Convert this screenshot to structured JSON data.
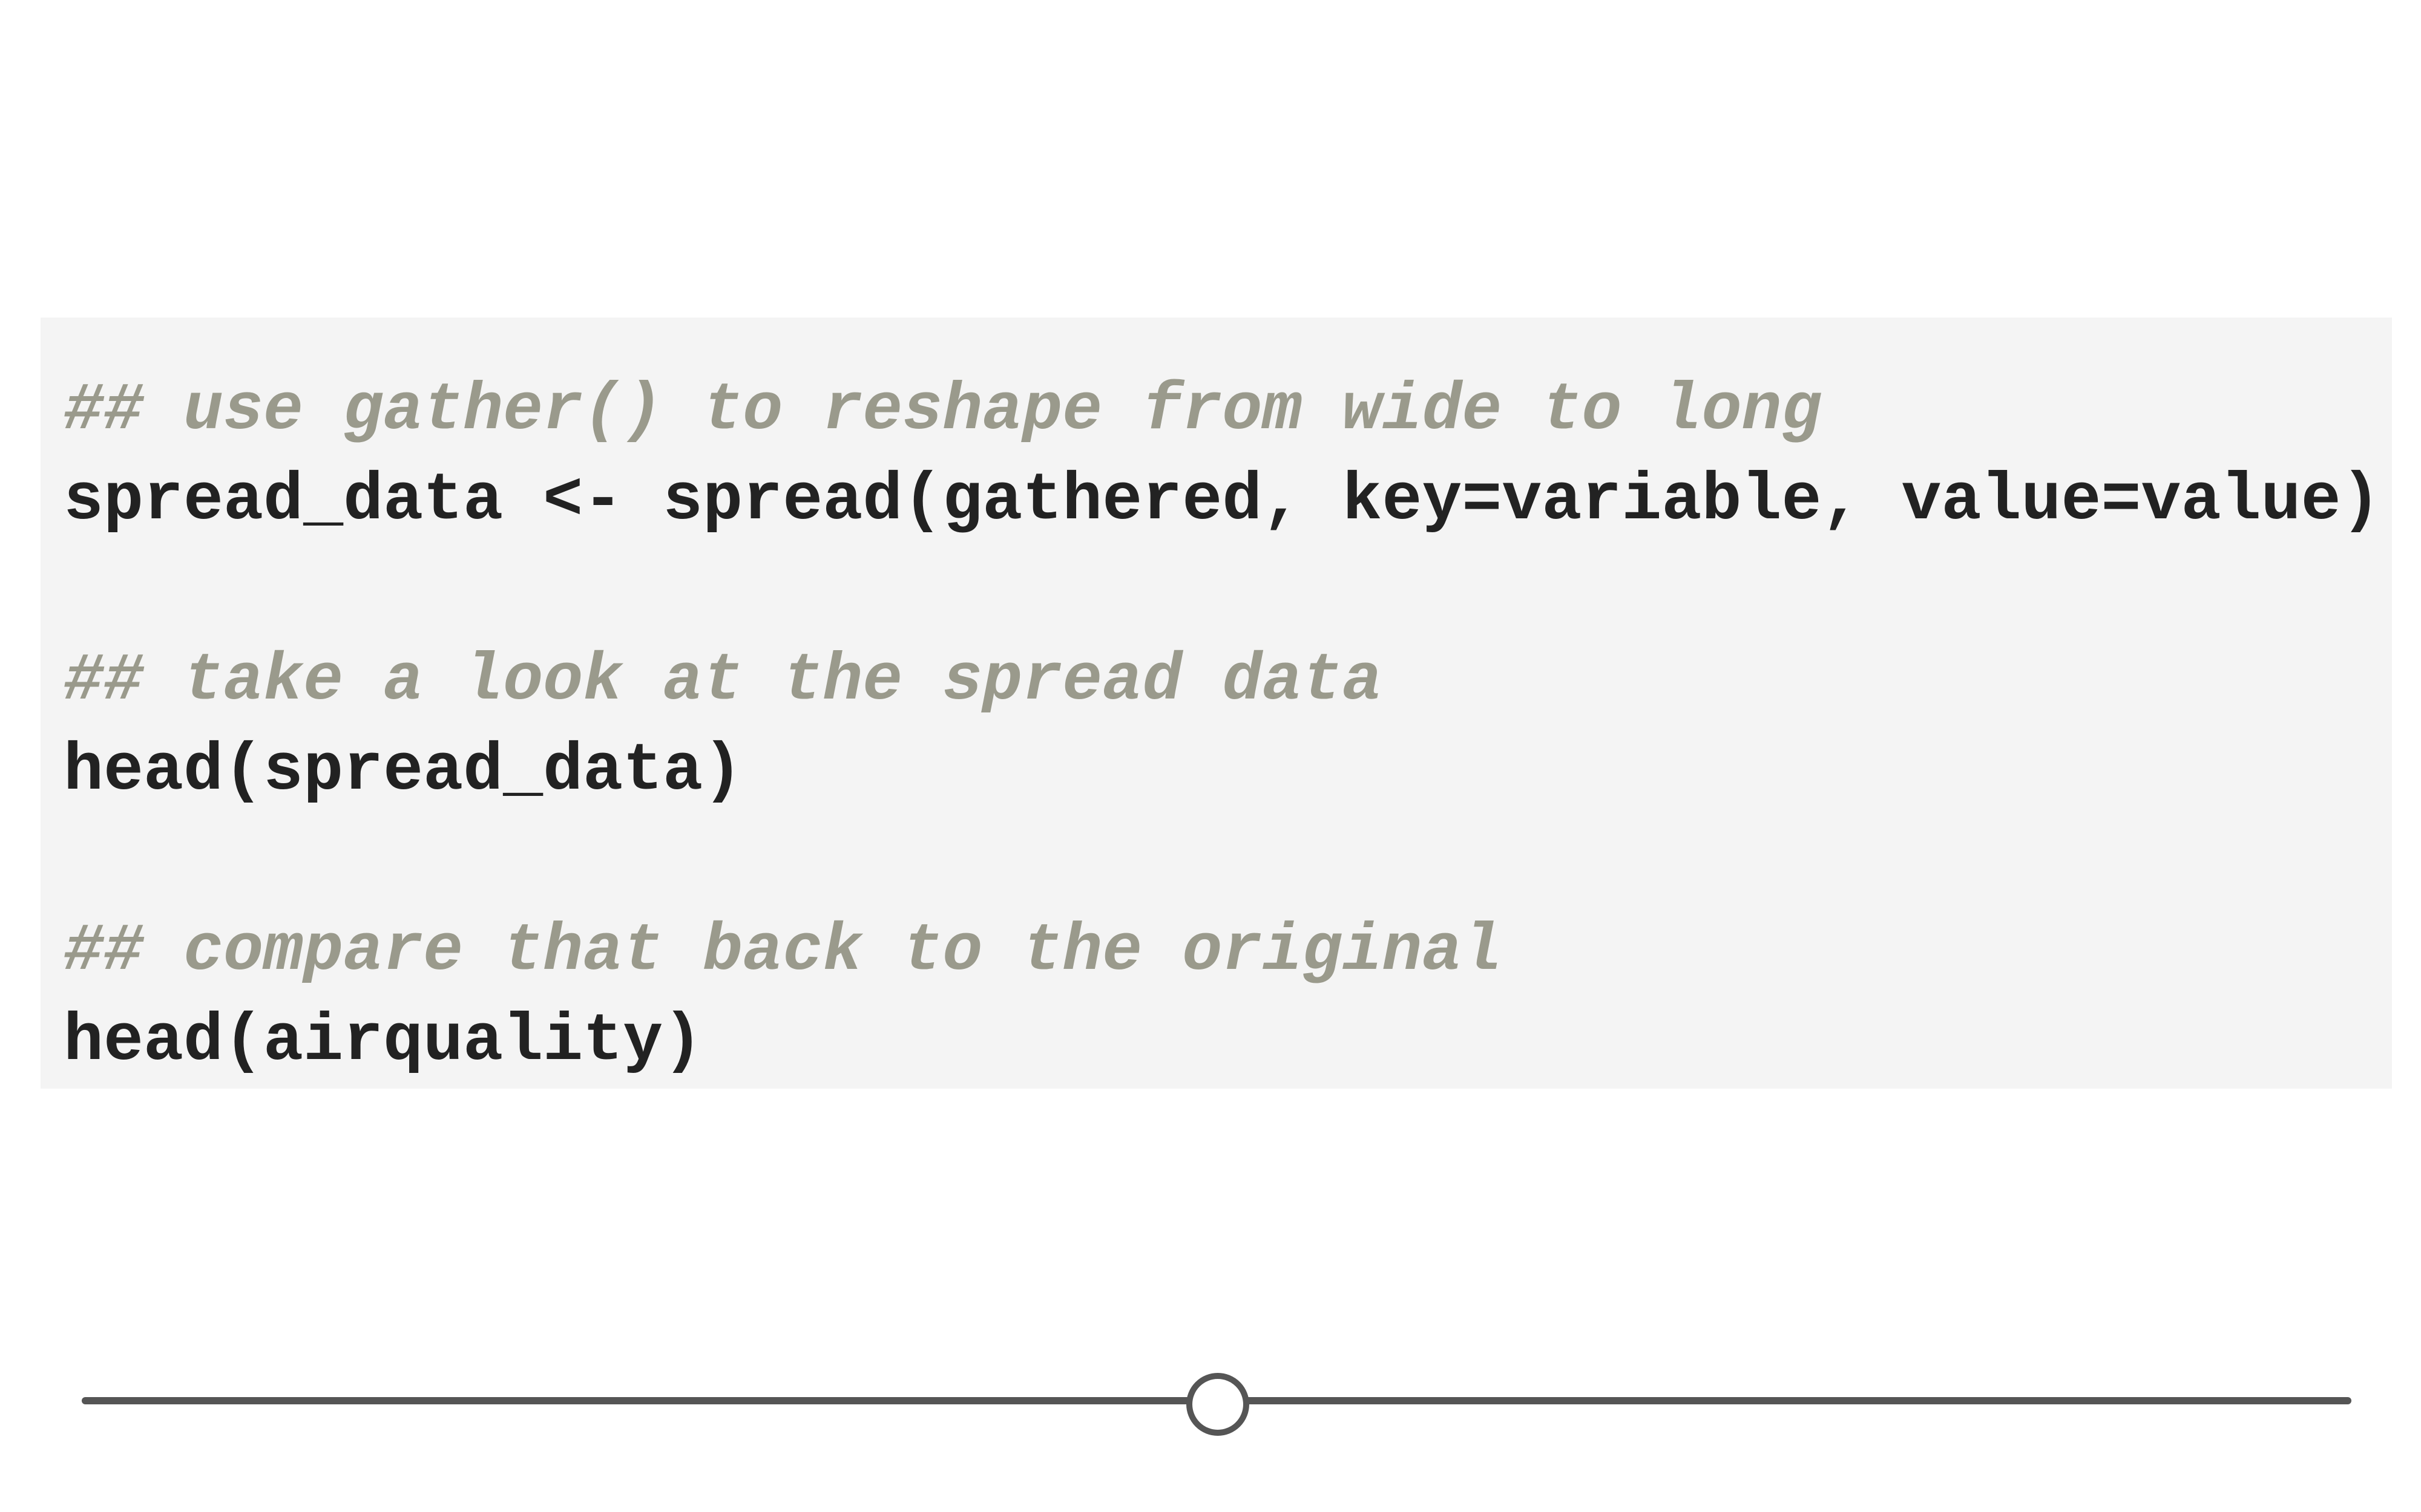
{
  "code": {
    "lines": [
      {
        "type": "comment",
        "text": "## use gather() to reshape from wide to long"
      },
      {
        "type": "code",
        "text": "spread_data <- spread(gathered, key=variable, value=value)"
      },
      {
        "type": "blank",
        "text": ""
      },
      {
        "type": "comment",
        "text": "## take a look at the spread data"
      },
      {
        "type": "code",
        "text": "head(spread_data)"
      },
      {
        "type": "blank",
        "text": ""
      },
      {
        "type": "comment",
        "text": "## compare that back to the original"
      },
      {
        "type": "code",
        "text": "head(airquality)"
      }
    ]
  },
  "slider": {
    "value": 0.5
  },
  "colors": {
    "code_background": "#f4f4f4",
    "code_text": "#222222",
    "comment_text": "#9a9a8c",
    "slider": "#555555"
  }
}
